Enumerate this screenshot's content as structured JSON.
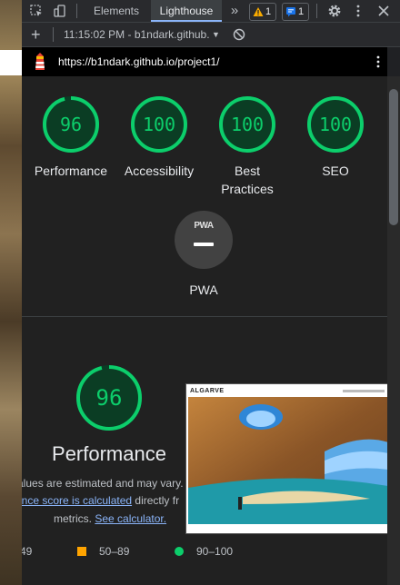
{
  "devtools": {
    "tabs": [
      "Elements",
      "Lighthouse"
    ],
    "more_glyph": "»",
    "warnings_count": "1",
    "messages_count": "1",
    "settings_icon": "gear-icon",
    "more_icon": "kebab-icon",
    "close_icon": "close-icon"
  },
  "report_selector": {
    "add_glyph": "+",
    "current_report": "11:15:02 PM - b1ndark.github.",
    "dropdown_glyph": "▼",
    "clear_icon": "block-icon"
  },
  "url_bar": {
    "url": "https://b1ndark.github.io/project1/",
    "menu_icon": "kebab-icon"
  },
  "categories": [
    {
      "score": "96",
      "label": "Performance",
      "fraction": 0.96
    },
    {
      "score": "100",
      "label": "Accessibility",
      "fraction": 1.0
    },
    {
      "score": "100",
      "label": "Best Practices",
      "fraction": 1.0
    },
    {
      "score": "100",
      "label": "SEO",
      "fraction": 1.0
    }
  ],
  "pwa": {
    "badge_text": "PWA",
    "label": "PWA"
  },
  "performance_section": {
    "score": "96",
    "fraction": 0.96,
    "title": "Performance",
    "note_line1": "alues are estimated and may vary.",
    "note_link1": "ance score is calculated",
    "note_line2_rest": "directly fr",
    "note_line3_start": "metrics.",
    "note_link2": "See calculator.",
    "screenshot_title": "ALGARVE"
  },
  "legend": [
    {
      "label": "49",
      "color": "#ff4e42"
    },
    {
      "label": "50–89",
      "color": "#ffa400"
    },
    {
      "label": "90–100",
      "color": "#0cce6b"
    }
  ],
  "colors": {
    "pass": "#0cce6b",
    "average": "#ffa400",
    "fail": "#ff4e42",
    "accent": "#8ab4f8"
  }
}
